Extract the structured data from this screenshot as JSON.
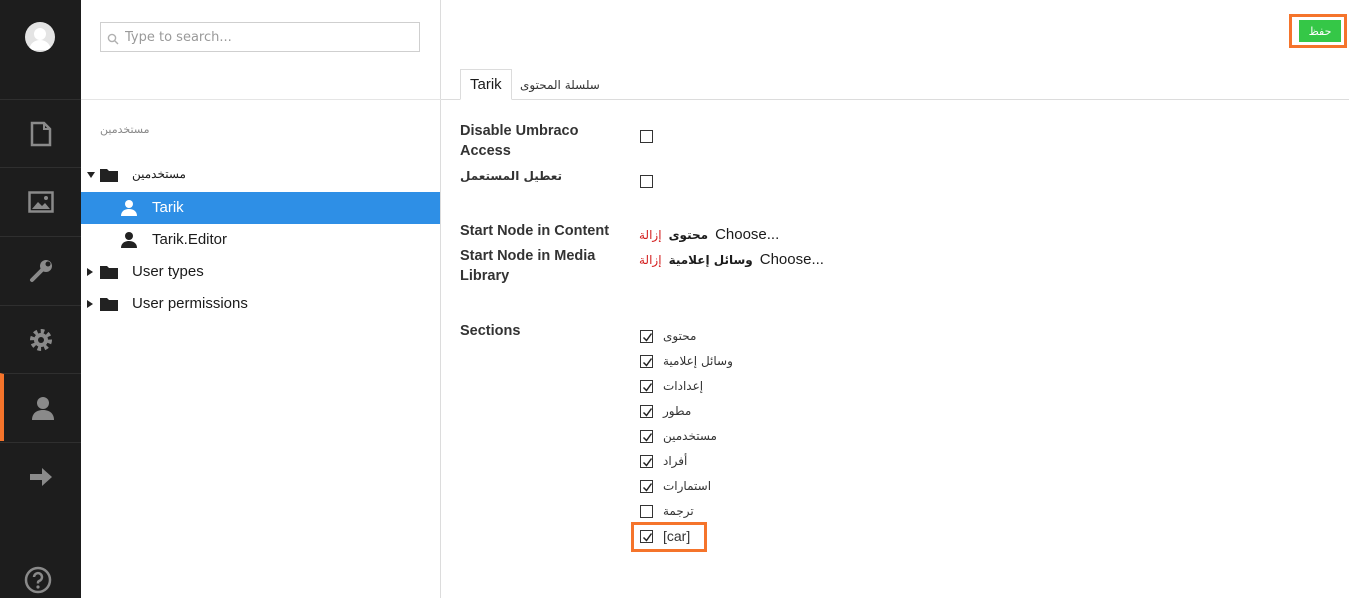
{
  "rail": {
    "icons": [
      "avatar-icon",
      "document-icon",
      "image-icon",
      "wrench-icon",
      "gear-icon",
      "user-icon",
      "arrow-right-icon",
      "help-icon"
    ],
    "accent": "#f5742b"
  },
  "tree": {
    "search_placeholder": "Type to search...",
    "root_label": "مستخدمين",
    "items": [
      {
        "label": "مستخدمين",
        "icon": "folder-icon",
        "expanded": true
      },
      {
        "label": "Tarik",
        "icon": "user-icon",
        "selected": true
      },
      {
        "label": "Tarik.Editor",
        "icon": "user-icon"
      },
      {
        "label": "User types",
        "icon": "folder-icon",
        "expanded": false
      },
      {
        "label": "User permissions",
        "icon": "folder-icon",
        "expanded": false
      }
    ],
    "selected_color": "#2e8fe6"
  },
  "main": {
    "save_label": "حفظ",
    "save_color": "#35c747",
    "tabs": [
      {
        "label": "Tarik",
        "active": true
      },
      {
        "label": "سلسلة المحتوى",
        "active": false
      }
    ],
    "fields": {
      "disable_access": {
        "label": "Disable Umbraco Access",
        "checked": false
      },
      "disable_user": {
        "label": "تعطيل المستعمل",
        "checked": false
      },
      "start_content": {
        "label": "Start Node in Content",
        "remove": "إزالة",
        "node": "محتوى",
        "choose": "Choose..."
      },
      "start_media": {
        "label": "Start Node in Media Library",
        "remove": "إزالة",
        "node": "وسائل إعلامية",
        "choose": "Choose..."
      },
      "sections_label": "Sections"
    },
    "sections": [
      {
        "label": "محتوى",
        "checked": true
      },
      {
        "label": "وسائل إعلامية",
        "checked": true
      },
      {
        "label": "إعدادات",
        "checked": true
      },
      {
        "label": "مطور",
        "checked": true
      },
      {
        "label": "مستخدمين",
        "checked": true
      },
      {
        "label": "أفراد",
        "checked": true
      },
      {
        "label": "استمارات",
        "checked": true
      },
      {
        "label": "ترجمة",
        "checked": false
      },
      {
        "label": "[car]",
        "checked": true
      }
    ],
    "highlight_color": "#f5742b"
  }
}
